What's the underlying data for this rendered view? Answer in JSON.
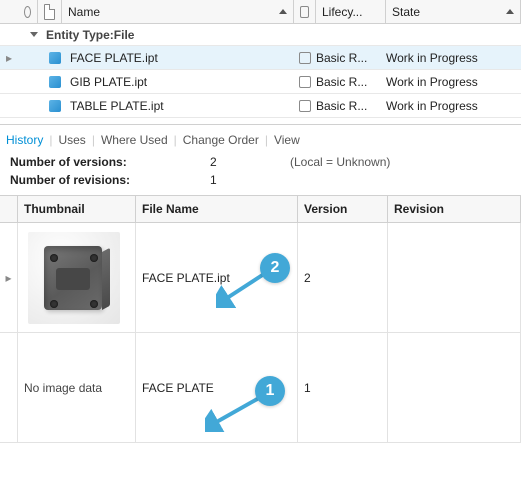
{
  "header": {
    "name": "Name",
    "lifecycle": "Lifecy...",
    "state": "State"
  },
  "group": {
    "label": "Entity Type:File"
  },
  "rows": [
    {
      "name": "FACE PLATE.ipt",
      "lifecycle": "Basic R...",
      "state": "Work in Progress",
      "selected": true
    },
    {
      "name": "GIB PLATE.ipt",
      "lifecycle": "Basic R...",
      "state": "Work in Progress",
      "selected": false
    },
    {
      "name": "TABLE PLATE.ipt",
      "lifecycle": "Basic R...",
      "state": "Work in Progress",
      "selected": false
    }
  ],
  "tabs": {
    "t0": "History",
    "t1": "Uses",
    "t2": "Where Used",
    "t3": "Change Order",
    "t4": "View"
  },
  "meta": {
    "versions_label": "Number of versions:",
    "versions_value": "2",
    "versions_extra": "(Local = Unknown)",
    "revisions_label": "Number of revisions:",
    "revisions_value": "1"
  },
  "grid": {
    "thumbnail": "Thumbnail",
    "filename": "File Name",
    "version": "Version",
    "revision": "Revision"
  },
  "grid_rows": [
    {
      "thumb": "image",
      "filename": "FACE PLATE.ipt",
      "version": "2",
      "revision": ""
    },
    {
      "thumb": "none",
      "no_img_text": "No image data",
      "filename": "FACE PLATE",
      "version": "1",
      "revision": ""
    }
  ],
  "callouts": {
    "b1": "1",
    "b2": "2"
  }
}
